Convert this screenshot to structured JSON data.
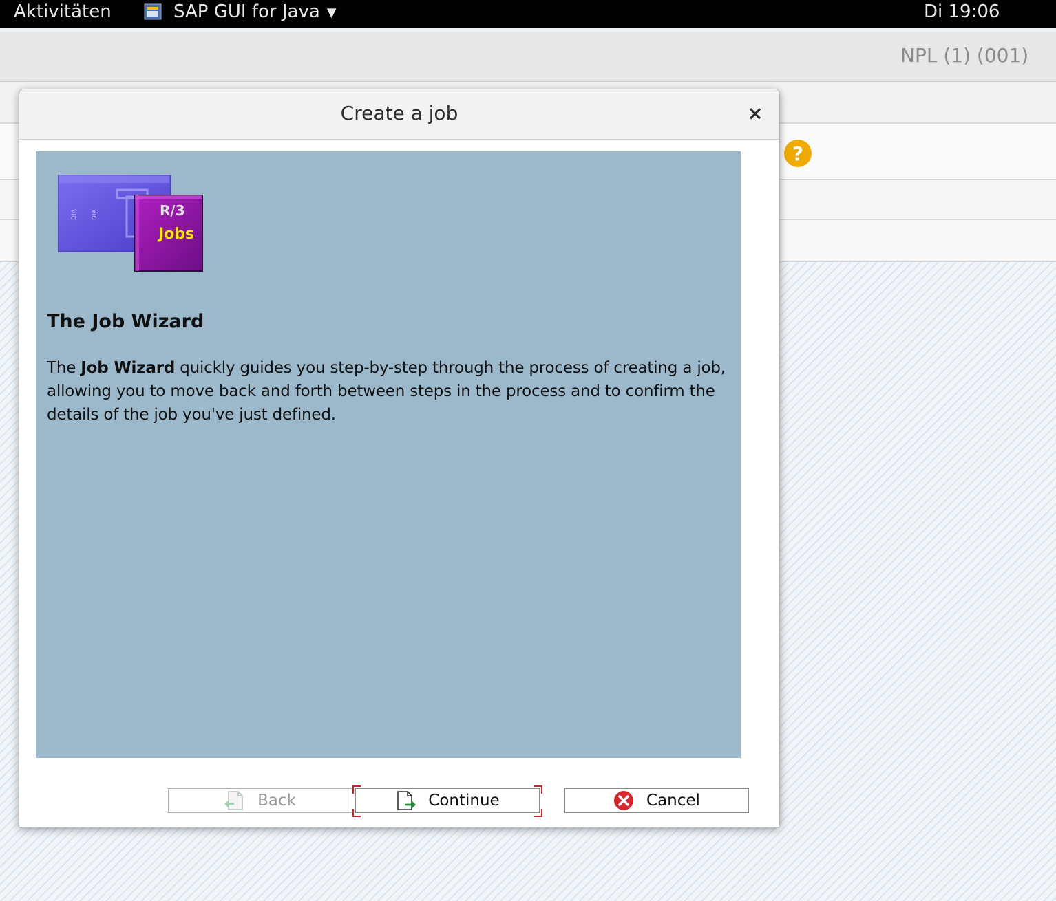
{
  "topbar": {
    "activities": "Aktivitäten",
    "app_name": "SAP GUI for Java",
    "clock": "Di 19:06"
  },
  "sap": {
    "system_info": "NPL (1) (001)"
  },
  "dialog": {
    "title": "Create a job",
    "close_symbol": "×",
    "logo": {
      "line1": "R/3",
      "line2": "Jobs"
    },
    "heading": "The Job Wizard",
    "text_pre": "The ",
    "text_bold": "Job Wizard",
    "text_post": " quickly guides you step-by-step through the process of creating a job, allowing you to move back and forth between steps in the process and to confirm the details of the job you've just defined.",
    "buttons": {
      "back": "Back",
      "continue": "Continue",
      "cancel": "Cancel"
    }
  },
  "icons": {
    "help": "?",
    "help_color": "#f0ab00",
    "cancel_color": "#d9262c",
    "continue_arrow_color": "#1f8f3a"
  }
}
